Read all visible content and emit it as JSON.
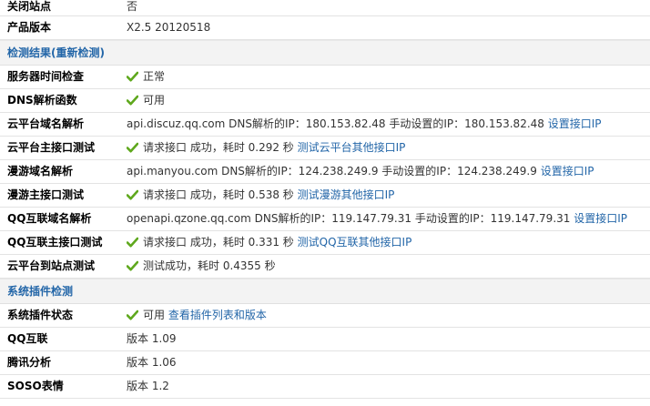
{
  "rows_top": [
    {
      "label": "关闭站点",
      "value": "否"
    },
    {
      "label": "产品版本",
      "value": "X2.5 20120518"
    }
  ],
  "section_check": {
    "title": "检测结果(重新检测)"
  },
  "check_rows": [
    {
      "label": "服务器时间检查",
      "value": "正常",
      "check": true
    },
    {
      "label": "DNS解析函数",
      "value": "可用",
      "check": true
    },
    {
      "label": "云平台域名解析",
      "value": "api.discuz.qq.com DNS解析的IP：180.153.82.48 手动设置的IP：180.153.82.48",
      "link": "设置接口IP"
    },
    {
      "label": "云平台主接口测试",
      "value": "请求接口 成功，耗时 0.292 秒",
      "check": true,
      "link": "测试云平台其他接口IP"
    },
    {
      "label": "漫游域名解析",
      "value": "api.manyou.com DNS解析的IP：124.238.249.9 手动设置的IP：124.238.249.9",
      "link": "设置接口IP"
    },
    {
      "label": "漫游主接口测试",
      "value": "请求接口 成功，耗时 0.538 秒",
      "check": true,
      "link": "测试漫游其他接口IP"
    },
    {
      "label": "QQ互联域名解析",
      "value": "openapi.qzone.qq.com DNS解析的IP：119.147.79.31 手动设置的IP：119.147.79.31",
      "link": "设置接口IP"
    },
    {
      "label": "QQ互联主接口测试",
      "value": "请求接口 成功，耗时 0.331 秒",
      "check": true,
      "link": "测试QQ互联其他接口IP"
    },
    {
      "label": "云平台到站点测试",
      "value": "测试成功，耗时 0.4355 秒",
      "check": true
    }
  ],
  "section_plugins": {
    "title": "系统插件检测"
  },
  "plugin_rows": [
    {
      "label": "系统插件状态",
      "value": "可用",
      "check": true,
      "link": "查看插件列表和版本"
    },
    {
      "label": "QQ互联",
      "value": "版本 1.09"
    },
    {
      "label": "腾讯分析",
      "value": "版本 1.06"
    },
    {
      "label": "SOSO表情",
      "value": "版本 1.2"
    }
  ],
  "colors": {
    "link": "#2366a8",
    "check": "#5fa81d"
  }
}
